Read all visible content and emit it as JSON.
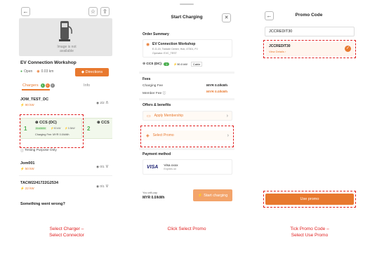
{
  "panel1": {
    "image_placeholder": "Image is not available",
    "station_name": "EV Connection Workshop",
    "status": "Open",
    "distance": "0.03 km",
    "directions_label": "Directions",
    "tabs": {
      "chargers_label": "Chargers",
      "badge1": "1",
      "badge2": "0",
      "badge3": "2",
      "info_label": "Info"
    },
    "chargers": [
      {
        "name": "JOM_TEST_DC",
        "power": "90 kW",
        "avail": "2/2"
      },
      {
        "name": "Jom001",
        "power": "50 kW",
        "avail": "0/1"
      },
      {
        "name": "TACW2241722G2534",
        "power": "22 kW",
        "avail": "0/1"
      }
    ],
    "connector1": {
      "num": "1",
      "type": "CCS (DC)",
      "tag": "Available",
      "power": "90 kW",
      "volt": "0.5kW",
      "fee": "Charging Fee: MYR 0.0/kWh"
    },
    "connector2": {
      "num": "2",
      "type": "CCS"
    },
    "testing_note": "Testing Purpose Only",
    "footer": "Something went wrong?"
  },
  "panel2": {
    "title": "Start Charging",
    "close": "✕",
    "order_summary": "Order Summary",
    "ws_name": "EV Connection Workshop",
    "ws_addr": "E-G-15, Tioldale Centre, Hub, 47301, PJ",
    "ws_operator": "Operator: EVC_TEST",
    "connector": "CCS (DC)",
    "connector_num": "1",
    "power": "90.0 kW",
    "cable": "Cable",
    "fees_title": "Fees",
    "charging_fee_label": "Charging Fee",
    "charging_fee_val": "MYR 0.0/kWh",
    "member_fee_label": "Member Fee",
    "member_fee_val": "MYR 0.0/kWh",
    "offers_title": "Offers & benefits",
    "apply_membership": "Apply Membership",
    "select_promo": "Select Promo",
    "payment_title": "Payment method",
    "visa_logo": "VISA",
    "visa_name": "Visa xxxx",
    "visa_expiry": "Expires on",
    "will_pay": "You will pay",
    "pay_amount": "MYR 0.0/kWh",
    "start_btn": "Start charging"
  },
  "panel3": {
    "title": "Promo Code",
    "input_value": "JCCREDIT30",
    "promo_name": "JCCREDIT30",
    "view_details": "View Details ›",
    "use_promo": "Use promo"
  },
  "captions": {
    "c1_line1": "Select Charger –",
    "c1_line2": "Select Connector",
    "c2": "Click Select Promo",
    "c3_line1": "Tick Promo Code –",
    "c3_line2": "Select Use Promo"
  },
  "colors": {
    "accent": "#e8792f",
    "annotation": "#e02020",
    "green": "#4caf50"
  }
}
